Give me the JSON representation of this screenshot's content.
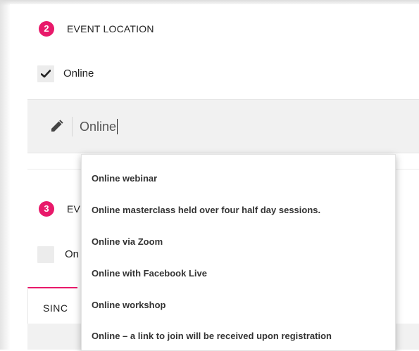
{
  "section_event_location": {
    "step_number": "2",
    "title": "EVENT LOCATION",
    "online_checkbox_label": "Online",
    "online_checked": true,
    "location_input_value": "Online"
  },
  "section_next": {
    "step_number": "3",
    "title_partial": "EV",
    "checkbox_label_partial": "On",
    "checked": false,
    "tab_label_partial": "SINC"
  },
  "autocomplete": {
    "items": [
      "Online webinar",
      "Online masterclass held over four half day sessions.",
      "Online via Zoom",
      "Online with Facebook Live",
      "Online workshop",
      "Online – a link to join will be received upon registration"
    ]
  },
  "colors": {
    "accent": "#e8196a",
    "input_bg": "#f1f1f1",
    "checkbox_bg": "#ececec"
  },
  "icons": {
    "edit": "pencil-icon",
    "check": "checkmark-icon"
  }
}
